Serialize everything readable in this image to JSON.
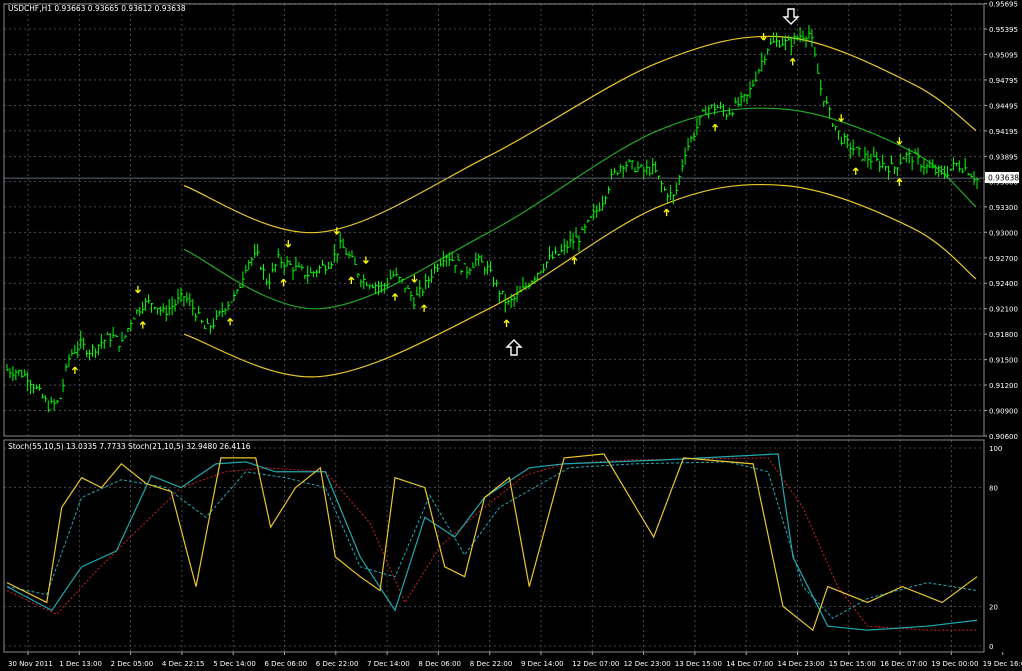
{
  "main_panel": {
    "header": "USDCHF,H1  0.93663 0.93665 0.93612 0.93638",
    "price_tag": "0.93638"
  },
  "sub_panel": {
    "header": "Stoch(55,10,5) 13.0335 7.7733   Stoch(21,10,5) 32.9480 26.4116"
  },
  "colors": {
    "background": "#000000",
    "grid": "#5a5a5a",
    "bars": "#00ff00",
    "channel_outer": "#e8c72c",
    "channel_mid": "#23a623",
    "arrows": "#ffff00",
    "big_arrow": "#ffffff",
    "price_line": "#7a8ca0",
    "stoch1_main": "#e8c72c",
    "stoch2_main": "#20a8b0",
    "stoch_signal_a": "#d02020",
    "stoch_signal_b": "#20a8b0"
  },
  "chart_data": [
    {
      "type": "bar",
      "symbol": "USDCHF",
      "timeframe": "H1",
      "ohlc_last": {
        "open": 0.93663,
        "high": 0.93665,
        "low": 0.93612,
        "close": 0.93638
      },
      "ylim": [
        0.906,
        0.9569
      ],
      "y_ticks": [
        "0.95695",
        "0.95395",
        "0.95095",
        "0.94795",
        "0.94495",
        "0.94195",
        "0.93895",
        "0.93600",
        "0.93300",
        "0.93000",
        "0.92700",
        "0.92400",
        "0.92100",
        "0.91800",
        "0.91500",
        "0.91200",
        "0.90900",
        "0.90600"
      ],
      "x_ticks": [
        "30 Nov 2011",
        "1 Dec 13:00",
        "2 Dec 05:00",
        "4 Dec 22:15",
        "5 Dec 14:00",
        "6 Dec 06:00",
        "6 Dec 22:00",
        "7 Dec 14:00",
        "8 Dec 06:00",
        "8 Dec 22:00",
        "9 Dec 14:00",
        "12 Dec 07:00",
        "12 Dec 23:00",
        "13 Dec 15:00",
        "14 Dec 07:00",
        "14 Dec 23:00",
        "15 Dec 15:00",
        "16 Dec 07:00",
        "19 Dec 00:00",
        "19 Dec 16:00"
      ],
      "close_path_keypoints": [
        [
          0,
          0.9138
        ],
        [
          2,
          0.9136
        ],
        [
          4,
          0.913
        ],
        [
          5,
          0.9112
        ],
        [
          6,
          0.9095
        ],
        [
          7,
          0.91
        ],
        [
          8,
          0.9155
        ],
        [
          9,
          0.9168
        ],
        [
          10,
          0.916
        ],
        [
          11,
          0.917
        ],
        [
          12,
          0.9178
        ],
        [
          13,
          0.9168
        ],
        [
          14,
          0.92
        ],
        [
          15,
          0.9215
        ],
        [
          16,
          0.9218
        ],
        [
          17,
          0.9205
        ],
        [
          18,
          0.9215
        ],
        [
          19,
          0.9225
        ],
        [
          20,
          0.9208
        ],
        [
          21,
          0.9185
        ],
        [
          22,
          0.9195
        ],
        [
          23,
          0.9215
        ],
        [
          24,
          0.9225
        ],
        [
          25,
          0.9265
        ],
        [
          26,
          0.9272
        ],
        [
          27,
          0.924
        ],
        [
          28,
          0.9268
        ],
        [
          29,
          0.9262
        ],
        [
          30,
          0.9255
        ],
        [
          31,
          0.925
        ],
        [
          32,
          0.9258
        ],
        [
          33,
          0.9265
        ],
        [
          34,
          0.9285
        ],
        [
          35,
          0.9268
        ],
        [
          36,
          0.9245
        ],
        [
          37,
          0.924
        ],
        [
          38,
          0.9235
        ],
        [
          39,
          0.925
        ],
        [
          40,
          0.924
        ],
        [
          41,
          0.922
        ],
        [
          42,
          0.9235
        ],
        [
          43,
          0.9258
        ],
        [
          44,
          0.9275
        ],
        [
          45,
          0.9265
        ],
        [
          46,
          0.9255
        ],
        [
          47,
          0.9268
        ],
        [
          48,
          0.9258
        ],
        [
          49,
          0.9235
        ],
        [
          50,
          0.9215
        ],
        [
          51,
          0.9225
        ],
        [
          52,
          0.924
        ],
        [
          53,
          0.9255
        ],
        [
          54,
          0.9268
        ],
        [
          55,
          0.9275
        ],
        [
          56,
          0.9288
        ],
        [
          57,
          0.9295
        ],
        [
          58,
          0.9315
        ],
        [
          59,
          0.9335
        ],
        [
          60,
          0.9365
        ],
        [
          61,
          0.9382
        ],
        [
          62,
          0.9378
        ],
        [
          63,
          0.9372
        ],
        [
          64,
          0.9375
        ],
        [
          65,
          0.935
        ],
        [
          66,
          0.934
        ],
        [
          67,
          0.9395
        ],
        [
          68,
          0.942
        ],
        [
          69,
          0.9445
        ],
        [
          70,
          0.9448
        ],
        [
          71,
          0.944
        ],
        [
          72,
          0.945
        ],
        [
          73,
          0.946
        ],
        [
          74,
          0.949
        ],
        [
          75,
          0.952
        ],
        [
          76,
          0.9525
        ],
        [
          77,
          0.9522
        ],
        [
          78,
          0.9532
        ],
        [
          79,
          0.9535
        ],
        [
          80,
          0.947
        ],
        [
          81,
          0.9435
        ],
        [
          82,
          0.941
        ],
        [
          83,
          0.94
        ],
        [
          84,
          0.939
        ],
        [
          85,
          0.9385
        ],
        [
          86,
          0.938
        ],
        [
          87,
          0.9375
        ],
        [
          88,
          0.939
        ],
        [
          89,
          0.9388
        ],
        [
          90,
          0.9378
        ],
        [
          91,
          0.9372
        ],
        [
          92,
          0.937
        ],
        [
          93,
          0.938
        ],
        [
          94,
          0.9375
        ],
        [
          95,
          0.9362
        ]
      ],
      "channel": {
        "upper": [
          [
            0.8,
            0.9355
          ],
          [
            4,
            0.93
          ],
          [
            8,
            0.939
          ],
          [
            12,
            0.95
          ],
          [
            15,
            0.953
          ],
          [
            18,
            0.9475
          ],
          [
            19.5,
            0.942
          ]
        ],
        "middle": [
          [
            0.8,
            0.928
          ],
          [
            4,
            0.921
          ],
          [
            8,
            0.93
          ],
          [
            12,
            0.942
          ],
          [
            15,
            0.9445
          ],
          [
            18,
            0.9395
          ],
          [
            19.5,
            0.933
          ]
        ],
        "lower": [
          [
            0.8,
            0.918
          ],
          [
            4,
            0.913
          ],
          [
            8,
            0.921
          ],
          [
            12,
            0.933
          ],
          [
            15,
            0.9355
          ],
          [
            18,
            0.9305
          ],
          [
            19.5,
            0.9245
          ]
        ]
      },
      "current_price": 0.93638,
      "arrows_down_count": 15,
      "arrows_up_count": 18
    },
    {
      "type": "line",
      "ylim": [
        0,
        100
      ],
      "y_ticks": [
        "100",
        "80",
        "20",
        "0"
      ],
      "levels": [
        20,
        80
      ],
      "series": [
        {
          "name": "Stoch(55,10,5)",
          "values_main_last": 13.0335,
          "values_signal_last": 7.7733
        },
        {
          "name": "Stoch(21,10,5)",
          "values_main_last": 32.948,
          "values_signal_last": 26.4116
        }
      ],
      "series_keypoints": {
        "stoch21_main": [
          [
            0,
            32
          ],
          [
            0.8,
            22
          ],
          [
            1.1,
            70
          ],
          [
            1.5,
            85
          ],
          [
            1.9,
            80
          ],
          [
            2.3,
            92
          ],
          [
            2.8,
            82
          ],
          [
            3.3,
            78
          ],
          [
            3.8,
            30
          ],
          [
            4.3,
            95
          ],
          [
            5,
            95
          ],
          [
            5.3,
            60
          ],
          [
            5.8,
            80
          ],
          [
            6.3,
            90
          ],
          [
            6.6,
            45
          ],
          [
            7.1,
            35
          ],
          [
            7.5,
            28
          ],
          [
            7.8,
            85
          ],
          [
            8.4,
            80
          ],
          [
            8.8,
            40
          ],
          [
            9.2,
            35
          ],
          [
            9.6,
            75
          ],
          [
            10.1,
            85
          ],
          [
            10.5,
            30
          ],
          [
            11.2,
            95
          ],
          [
            12,
            97
          ],
          [
            13,
            55
          ],
          [
            13.6,
            95
          ],
          [
            15,
            92
          ],
          [
            15.6,
            20
          ],
          [
            16.2,
            8
          ],
          [
            16.5,
            30
          ],
          [
            17.3,
            22
          ],
          [
            18,
            30
          ],
          [
            18.8,
            22
          ],
          [
            19.5,
            35
          ]
        ],
        "stoch55_main": [
          [
            0,
            30
          ],
          [
            0.9,
            18
          ],
          [
            1.5,
            40
          ],
          [
            2.2,
            48
          ],
          [
            2.9,
            86
          ],
          [
            3.5,
            80
          ],
          [
            4.2,
            92
          ],
          [
            4.8,
            93
          ],
          [
            5.4,
            88
          ],
          [
            6.4,
            88
          ],
          [
            7.1,
            45
          ],
          [
            7.8,
            18
          ],
          [
            8.4,
            65
          ],
          [
            9.0,
            55
          ],
          [
            9.6,
            75
          ],
          [
            10.5,
            90
          ],
          [
            11.2,
            92
          ],
          [
            13.2,
            94
          ],
          [
            15.5,
            97
          ],
          [
            15.8,
            45
          ],
          [
            16.5,
            10
          ],
          [
            17.3,
            8
          ],
          [
            18.5,
            10
          ],
          [
            19.5,
            13
          ]
        ],
        "stoch55_signal": [
          [
            0,
            28
          ],
          [
            1,
            16
          ],
          [
            1.8,
            38
          ],
          [
            2.6,
            58
          ],
          [
            3.5,
            80
          ],
          [
            4.4,
            88
          ],
          [
            5.2,
            90
          ],
          [
            6.4,
            88
          ],
          [
            7.3,
            62
          ],
          [
            8,
            22
          ],
          [
            8.7,
            50
          ],
          [
            9.5,
            68
          ],
          [
            10.4,
            86
          ],
          [
            11.2,
            92
          ],
          [
            12.5,
            94
          ],
          [
            15.3,
            95
          ],
          [
            16,
            70
          ],
          [
            16.7,
            30
          ],
          [
            17.3,
            10
          ],
          [
            18.5,
            8
          ],
          [
            19.5,
            8
          ]
        ],
        "stoch21_signal": [
          [
            0,
            30
          ],
          [
            0.8,
            26
          ],
          [
            1.5,
            75
          ],
          [
            2.3,
            84
          ],
          [
            3.2,
            80
          ],
          [
            4,
            65
          ],
          [
            4.8,
            88
          ],
          [
            5.6,
            85
          ],
          [
            6.4,
            80
          ],
          [
            7.1,
            40
          ],
          [
            7.8,
            35
          ],
          [
            8.5,
            76
          ],
          [
            9.2,
            46
          ],
          [
            9.9,
            70
          ],
          [
            10.6,
            80
          ],
          [
            11.3,
            90
          ],
          [
            12.6,
            92
          ],
          [
            14.5,
            93
          ],
          [
            15.3,
            88
          ],
          [
            16,
            30
          ],
          [
            16.6,
            14
          ],
          [
            17.3,
            24
          ],
          [
            18.5,
            32
          ],
          [
            19.5,
            28
          ]
        ]
      }
    }
  ]
}
